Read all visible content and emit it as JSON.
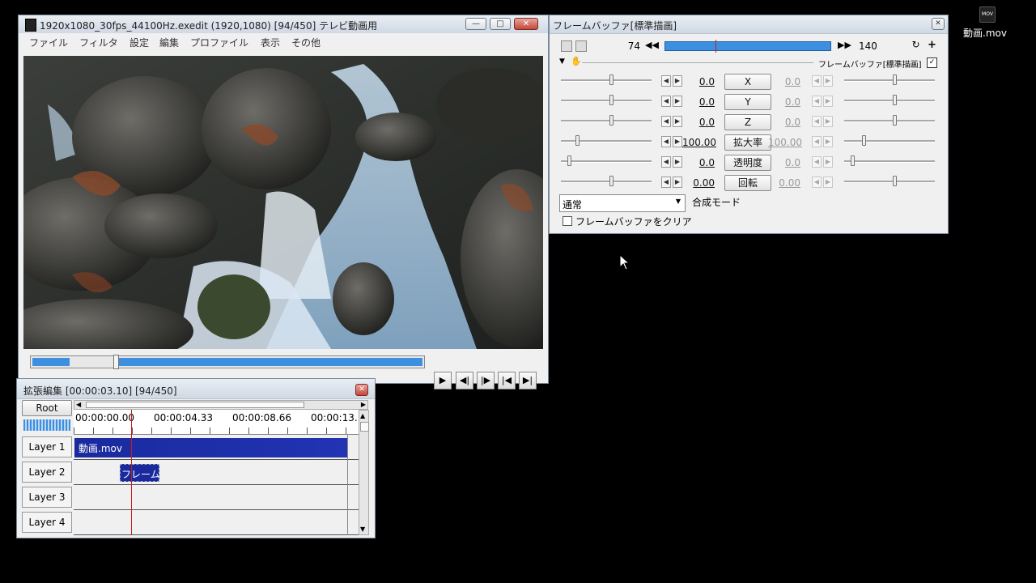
{
  "main_window": {
    "title": "1920x1080_30fps_44100Hz.exedit (1920,1080)  [94/450]  テレビ動画用",
    "menu": [
      "ファイル",
      "フィルタ",
      "設定",
      "編集",
      "プロファイル",
      "表示",
      "その他"
    ],
    "seek_progress": 0.21,
    "controls": [
      "▶",
      "◀|",
      "|▶",
      "|◀",
      "▶|"
    ]
  },
  "frame_buffer": {
    "title": "フレームバッファ[標準描画]",
    "start_frame": "74",
    "end_frame": "140",
    "object_label": "フレームバッファ[標準描画]",
    "params": [
      {
        "label": "X",
        "value": "0.0",
        "end": "0.0"
      },
      {
        "label": "Y",
        "value": "0.0",
        "end": "0.0"
      },
      {
        "label": "Z",
        "value": "0.0",
        "end": "0.0"
      },
      {
        "label": "拡大率",
        "value": "100.00",
        "end": "100.00"
      },
      {
        "label": "透明度",
        "value": "0.0",
        "end": "0.0"
      },
      {
        "label": "回転",
        "value": "0.00",
        "end": "0.00"
      }
    ],
    "blend_mode": "通常",
    "blend_label": "合成モード",
    "clear_label": "フレームバッファをクリア"
  },
  "timeline": {
    "title": "拡張編集 [00:00:03.10] [94/450]",
    "root_label": "Root",
    "ticks": [
      "00:00:00.00",
      "00:00:04.33",
      "00:00:08.66",
      "00:00:13."
    ],
    "layers": [
      "Layer 1",
      "Layer 2",
      "Layer 3",
      "Layer 4"
    ],
    "clip_video": "動画.mov",
    "clip_fb": "フレーム"
  },
  "desktop": {
    "icon_label": "動画.mov",
    "icon_badge": "MOV"
  },
  "colors": {
    "accent": "#3d8fe0",
    "clip": "#1a2a9e",
    "playhead": "#c02020"
  }
}
